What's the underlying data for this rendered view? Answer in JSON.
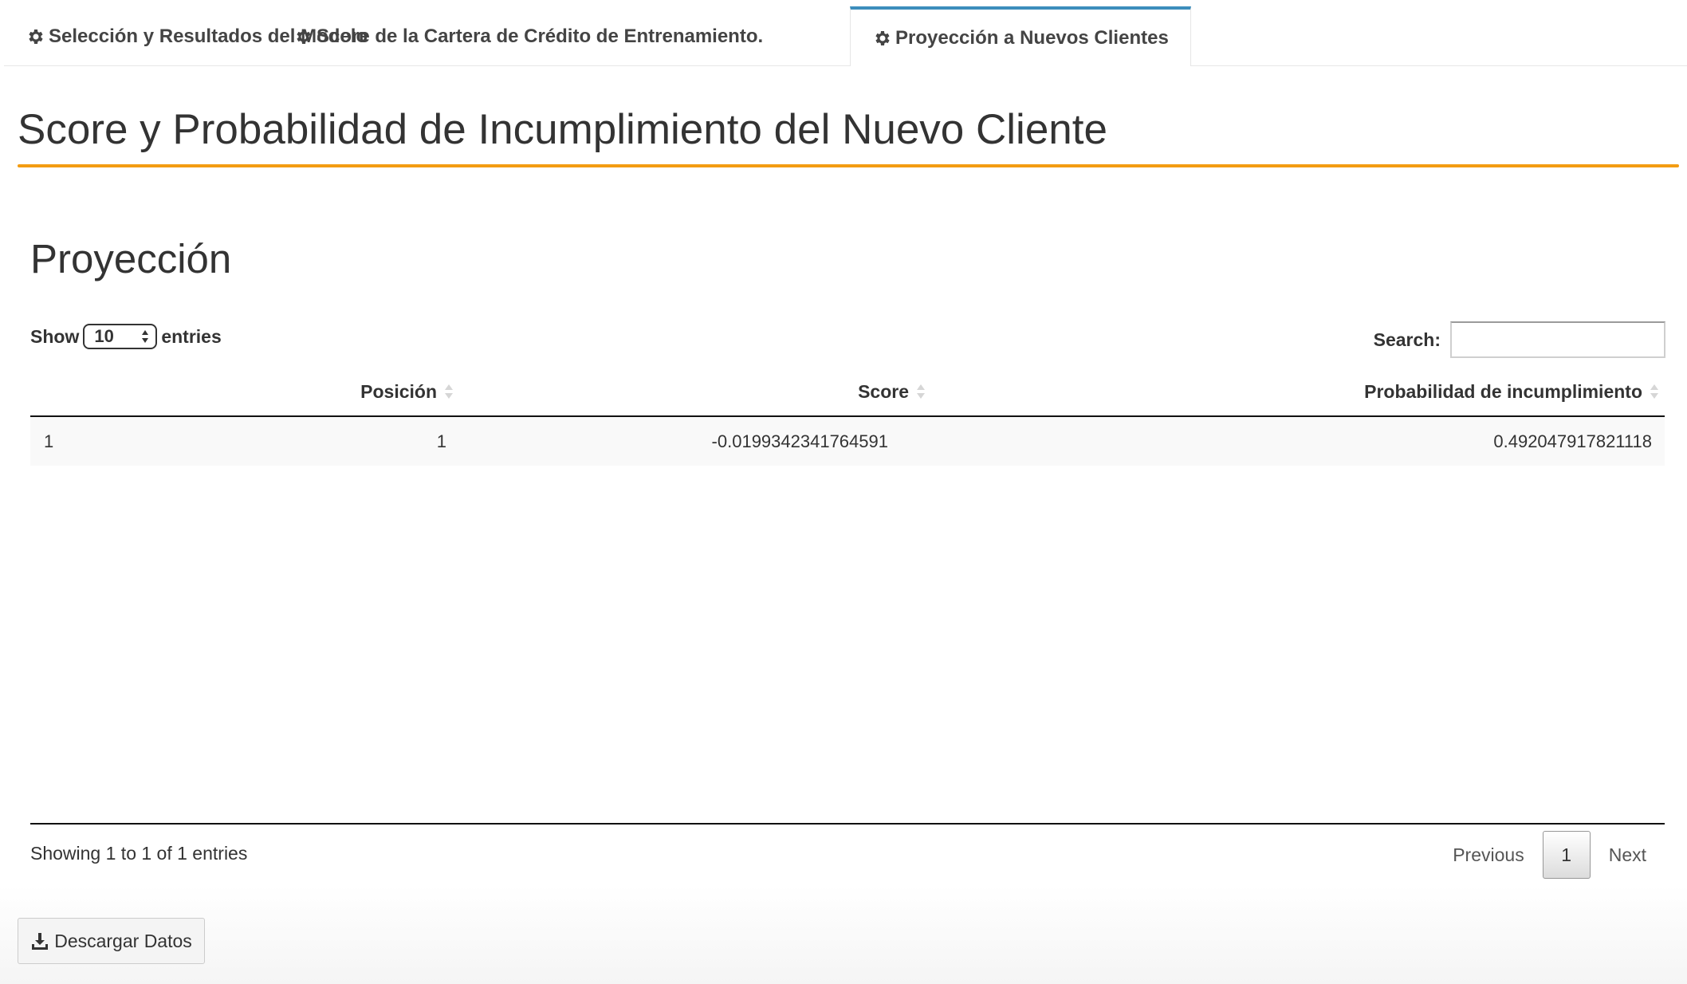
{
  "tabs": [
    {
      "label": "Selección y Resultados del Modelo",
      "icon": "gear-icon",
      "active": false
    },
    {
      "label": "Score de la Cartera de Crédito de Entrenamiento.",
      "icon": "gear-icon",
      "active": false
    },
    {
      "label": "Proyección a Nuevos Clientes",
      "icon": "gear-icon",
      "active": true
    }
  ],
  "header": {
    "title": "Score y Probabilidad de Incumplimiento del Nuevo Cliente"
  },
  "section": {
    "title": "Proyección"
  },
  "length_control": {
    "show_label": "Show",
    "selected": "10",
    "entries_label": "entries"
  },
  "search": {
    "label": "Search:",
    "value": "",
    "placeholder": ""
  },
  "table": {
    "columns": [
      "",
      "Posición",
      "Score",
      "Probabilidad de incumplimiento"
    ],
    "rows": [
      [
        "1",
        "1",
        "-0.0199342341764591",
        "0.492047917821118"
      ]
    ]
  },
  "footer": {
    "info": "Showing 1 to 1 of 1 entries",
    "previous": "Previous",
    "current_page": "1",
    "next": "Next"
  },
  "download": {
    "label": "Descargar Datos",
    "icon": "download-icon"
  },
  "colors": {
    "accent_rule": "#f39c12",
    "active_tab_border": "#3c8dbc"
  }
}
